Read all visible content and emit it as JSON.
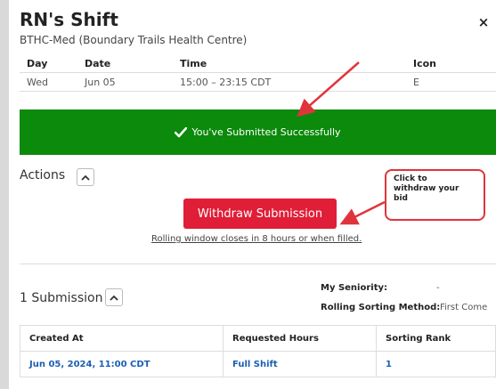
{
  "modal": {
    "title": "RN's Shift",
    "subtitle": "BTHC-Med (Boundary Trails Health Centre)",
    "close_label": "×"
  },
  "shift_table": {
    "headers": [
      "Day",
      "Date",
      "Time",
      "Icon"
    ],
    "row": [
      "Wed",
      "Jun 05",
      "15:00 – 23:15 CDT",
      "E"
    ]
  },
  "success_banner": {
    "text": "You've Submitted Successfully",
    "color": "#0b8a0b"
  },
  "actions": {
    "label": "Actions",
    "withdraw_label": "Withdraw Submission",
    "withdraw_color": "#e01e37",
    "rolling_text": "Rolling window closes in 8 hours or when filled."
  },
  "callout": {
    "lines": [
      "Click to",
      "withdraw your",
      "bid"
    ]
  },
  "submissions": {
    "label": "1 Submission",
    "seniority_label": "My Seniority:",
    "seniority_value": "-",
    "sorting_label": "Rolling Sorting Method:",
    "sorting_value": "First Come",
    "headers": [
      "Created At",
      "Requested Hours",
      "Sorting Rank"
    ],
    "row": [
      "Jun 05, 2024, 11:00 CDT",
      "Full Shift",
      "1"
    ]
  },
  "icons": {
    "close": "close-icon",
    "check": "check-icon",
    "collapse": "chevron-up-icon"
  }
}
